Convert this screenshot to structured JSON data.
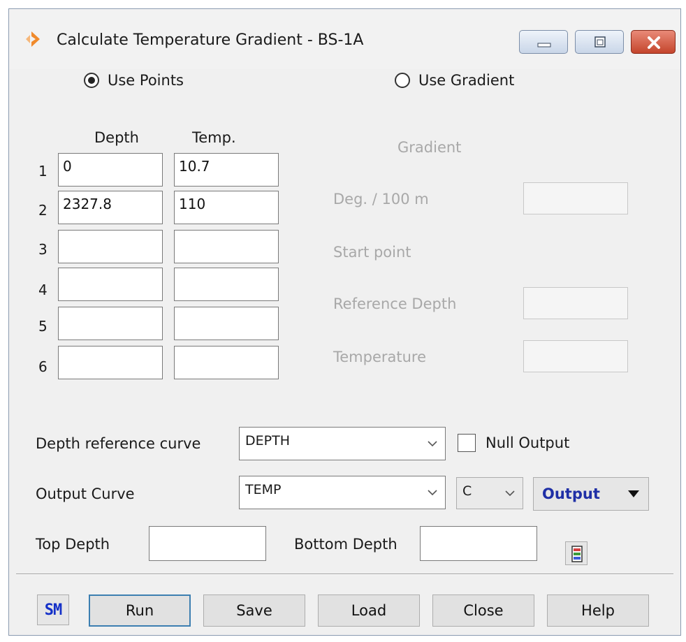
{
  "window": {
    "title": "Calculate Temperature Gradient - BS-1A",
    "controls": [
      "minimize-icon",
      "maximize-icon",
      "close-icon"
    ]
  },
  "mode": {
    "use_points": {
      "label": "Use Points",
      "selected": true
    },
    "use_gradient": {
      "label": "Use Gradient",
      "selected": false
    }
  },
  "points": {
    "depth_header": "Depth",
    "temp_header": "Temp.",
    "rows": [
      {
        "num": "1",
        "depth": "0",
        "temp": "10.7"
      },
      {
        "num": "2",
        "depth": "2327.8",
        "temp": "110"
      },
      {
        "num": "3",
        "depth": "",
        "temp": ""
      },
      {
        "num": "4",
        "depth": "",
        "temp": ""
      },
      {
        "num": "5",
        "depth": "",
        "temp": ""
      },
      {
        "num": "6",
        "depth": "",
        "temp": ""
      }
    ]
  },
  "gradient": {
    "header": "Gradient",
    "deg_label": "Deg. / 100 m",
    "start_point_label": "Start point",
    "reference_depth_label": "Reference Depth",
    "temperature_label": "Temperature"
  },
  "curves": {
    "depth_reference_label": "Depth reference curve",
    "depth_reference_value": "DEPTH",
    "null_output_label": "Null Output",
    "null_output_checked": false,
    "output_curve_label": "Output Curve",
    "output_curve_value": "TEMP",
    "unit_value": "C",
    "output_button_label": "Output"
  },
  "range": {
    "top_depth_label": "Top Depth",
    "top_depth_value": "",
    "bottom_depth_label": "Bottom Depth",
    "bottom_depth_value": ""
  },
  "footer": {
    "badge": "SM",
    "buttons": {
      "run": "Run",
      "save": "Save",
      "load": "Load",
      "close": "Close",
      "help": "Help"
    }
  },
  "colors": {
    "output_button_text": "#1f2fa6",
    "badge_text": "#1430c8",
    "app_icon": "#f08a2c",
    "close_button": "#c4452c"
  }
}
